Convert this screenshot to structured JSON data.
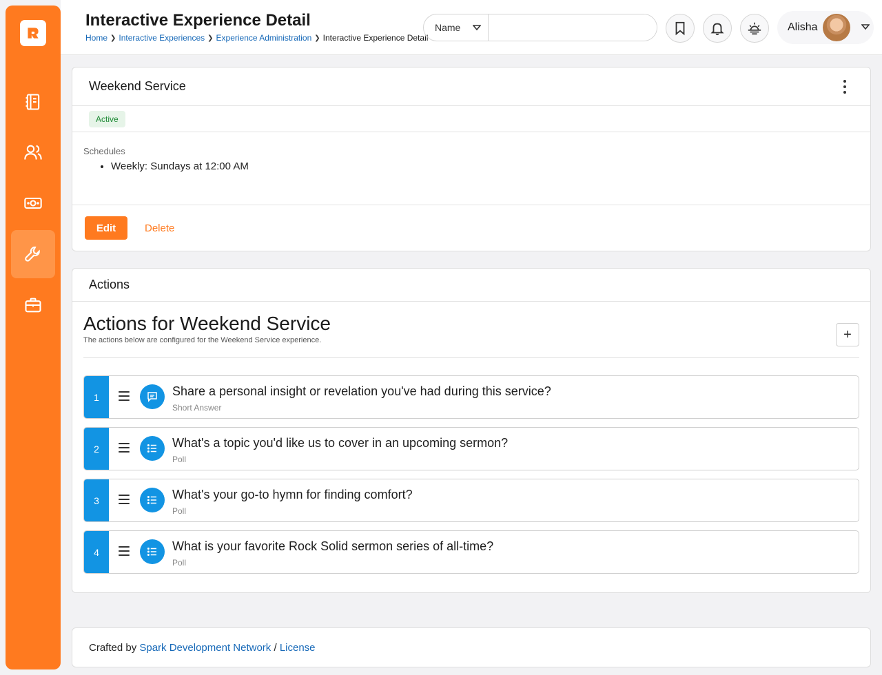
{
  "header": {
    "title": "Interactive Experience Detail",
    "breadcrumb": [
      "Home",
      "Interactive Experiences",
      "Experience Administration",
      "Interactive Experience Detail"
    ],
    "search": {
      "filter": "Name",
      "placeholder": ""
    },
    "user": {
      "name": "Alisha"
    }
  },
  "sidebar": {
    "items": [
      {
        "icon": "notebook-icon"
      },
      {
        "icon": "people-icon"
      },
      {
        "icon": "money-icon"
      },
      {
        "icon": "wrench-icon",
        "active": true
      },
      {
        "icon": "briefcase-icon"
      }
    ]
  },
  "experience_panel": {
    "title": "Weekend Service",
    "status": "Active",
    "schedules_label": "Schedules",
    "schedules": [
      "Weekly: Sundays at 12:00 AM"
    ],
    "edit_label": "Edit",
    "delete_label": "Delete"
  },
  "actions_panel": {
    "header": "Actions",
    "title": "Actions for Weekend Service",
    "subtitle": "The actions below are configured for the Weekend Service experience.",
    "add_label": "+",
    "items": [
      {
        "number": "1",
        "question": "Share a personal insight or revelation you've had during this service?",
        "type": "Short Answer",
        "icon": "chat-icon"
      },
      {
        "number": "2",
        "question": "What's a topic you'd like us to cover in an upcoming sermon?",
        "type": "Poll",
        "icon": "list-icon"
      },
      {
        "number": "3",
        "question": "What's your go-to hymn for finding comfort?",
        "type": "Poll",
        "icon": "list-icon"
      },
      {
        "number": "4",
        "question": "What is your favorite Rock Solid sermon series of all-time?",
        "type": "Poll",
        "icon": "list-icon"
      }
    ]
  },
  "footer": {
    "crafted_by": "Crafted by",
    "org": "Spark Development Network",
    "separator": "/",
    "license": "License"
  },
  "colors": {
    "brand": "#ff7a1f",
    "accent": "#1294e3",
    "link": "#1769b8"
  }
}
